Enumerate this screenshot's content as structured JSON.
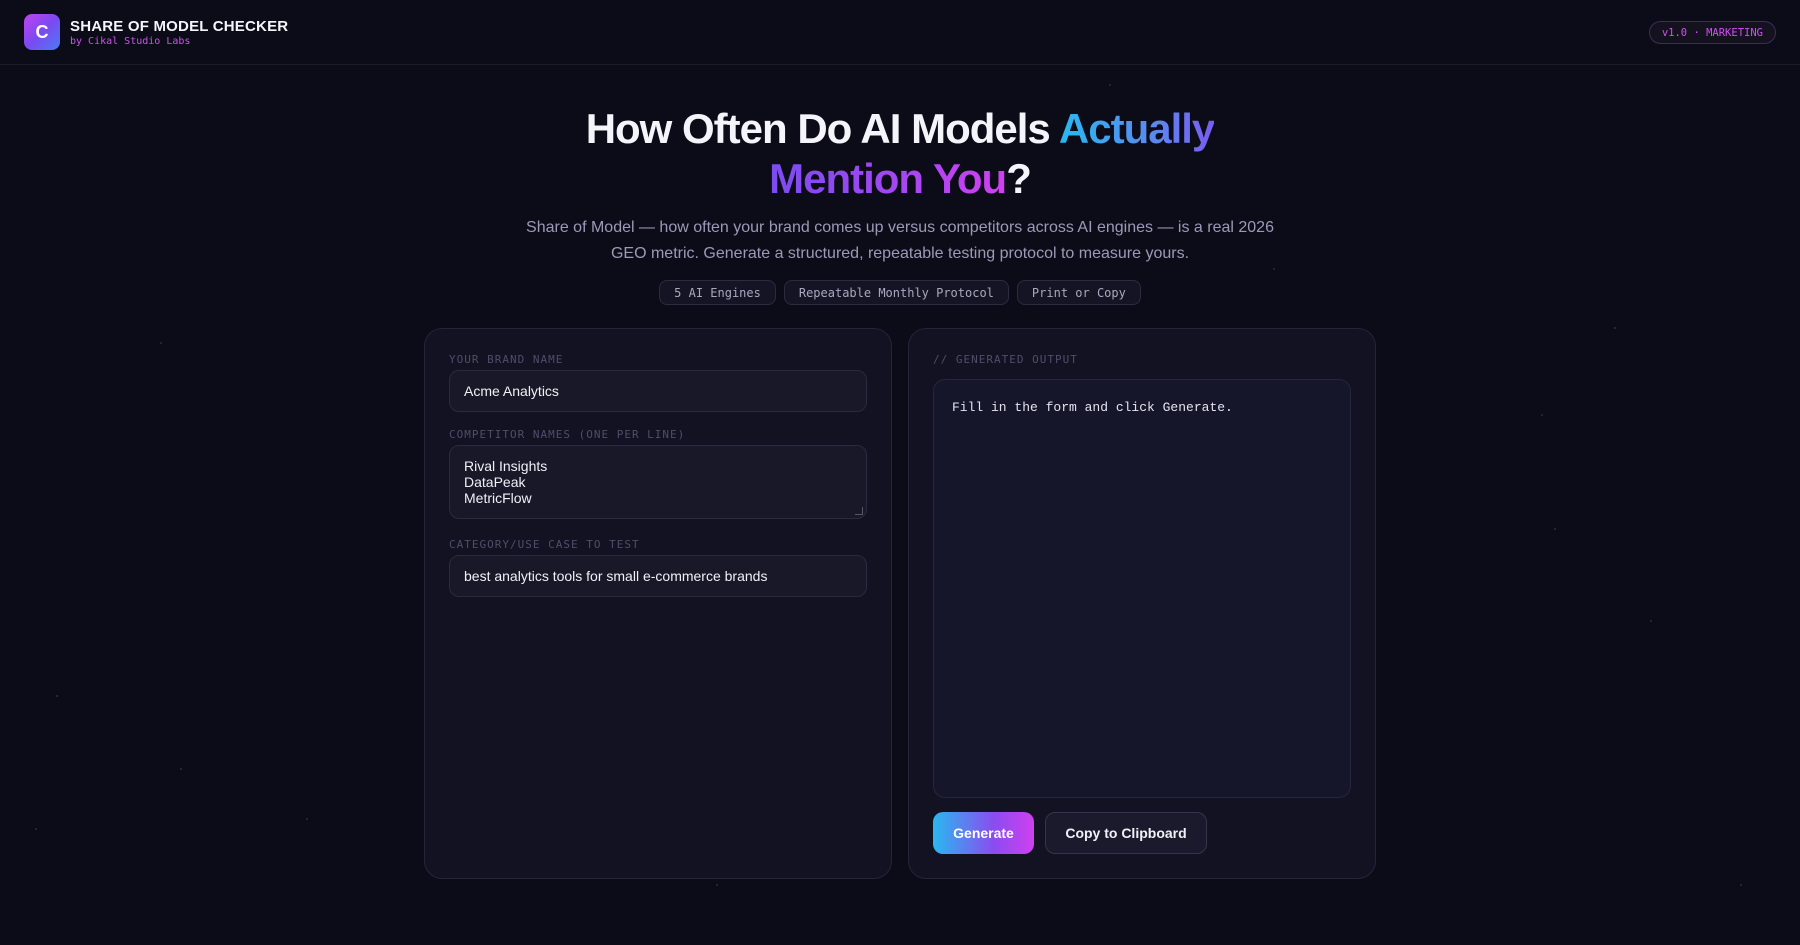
{
  "header": {
    "logo_letter": "C",
    "title": "SHARE OF MODEL CHECKER",
    "subtitle": "by Cikal Studio Labs",
    "version": "v1.0 · MARKETING"
  },
  "hero": {
    "title_part1": "How Often Do AI Models ",
    "title_highlight1": "Actually",
    "title_highlight2": "Mention You",
    "title_part2": "?",
    "description": "Share of Model — how often your brand comes up versus competitors across AI engines — is a real 2026 GEO metric. Generate a structured, repeatable testing protocol to measure yours.",
    "chips": [
      "5 AI Engines",
      "Repeatable Monthly Protocol",
      "Print or Copy"
    ]
  },
  "form": {
    "brand_label": "YOUR BRAND NAME",
    "brand_value": "Acme Analytics",
    "competitors_label": "COMPETITOR NAMES (ONE PER LINE)",
    "competitors": [
      "Rival Insights",
      "DataPeak",
      "MetricFlow"
    ],
    "category_label": "CATEGORY/USE CASE TO TEST",
    "category_value": "best analytics tools for small e-commerce brands"
  },
  "output": {
    "label": "// GENERATED OUTPUT",
    "placeholder_text": "Fill in the form and click Generate.",
    "generate_label": "Generate",
    "copy_label": "Copy to Clipboard"
  },
  "colors": {
    "background": "#0c0c18",
    "panel": "#121222",
    "accent_cyan": "#2ab8f0",
    "accent_purple": "#8a4cf0",
    "accent_magenta": "#d040f0"
  }
}
